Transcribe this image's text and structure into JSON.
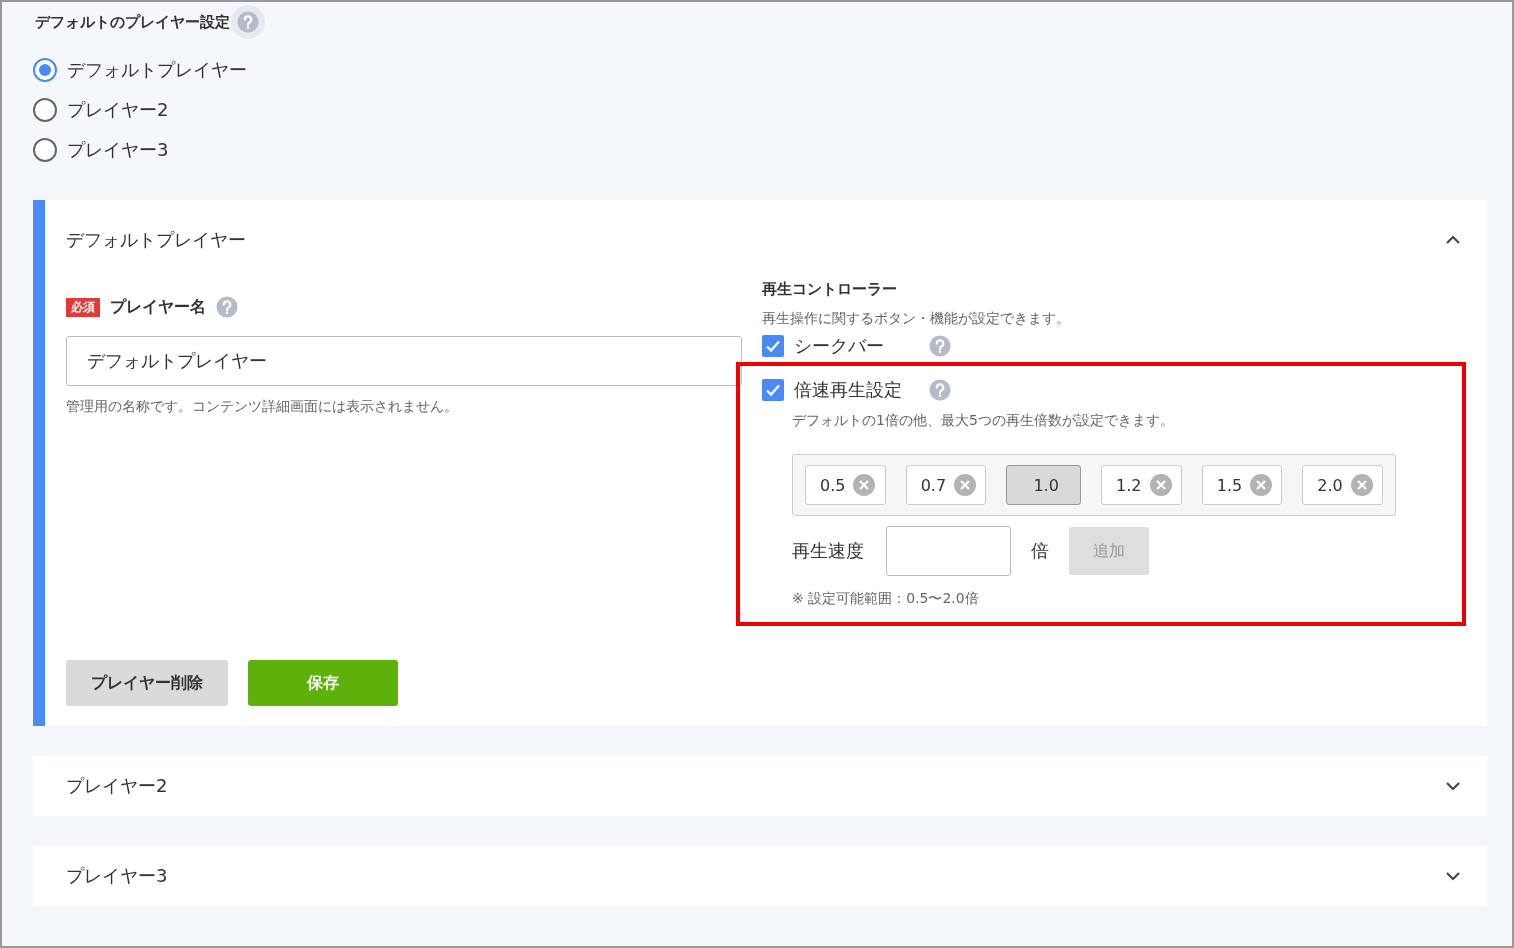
{
  "settings": {
    "title": "デフォルトのプレイヤー設定",
    "has_help": true
  },
  "player_options": [
    {
      "label": "デフォルトプレイヤー",
      "selected": true
    },
    {
      "label": "プレイヤー2",
      "selected": false
    },
    {
      "label": "プレイヤー3",
      "selected": false
    }
  ],
  "panels": [
    {
      "title": "デフォルトプレイヤー",
      "expanded": true,
      "name_field": {
        "required_badge": "必須",
        "label": "プレイヤー名",
        "value": "デフォルトプレイヤー",
        "hint": "管理用の名称です。コンテンツ詳細画面には表示されません。"
      },
      "controller": {
        "title": "再生コントローラー",
        "description": "再生操作に関するボタン・機能が設定できます。",
        "options": [
          {
            "label": "シークバー",
            "checked": true,
            "highlighted": false
          },
          {
            "label": "倍速再生設定",
            "checked": true,
            "highlighted": true,
            "description": "デフォルトの1倍の他、最大5つの再生倍数が設定できます。",
            "speeds": [
              {
                "label": "0.5",
                "kind": "removable"
              },
              {
                "label": "0.7",
                "kind": "removable"
              },
              {
                "label": "1.0",
                "kind": "default"
              },
              {
                "label": "1.2",
                "kind": "removable"
              },
              {
                "label": "1.5",
                "kind": "removable"
              },
              {
                "label": "2.0",
                "kind": "removable"
              }
            ],
            "speed_label": "再生速度",
            "unit": "倍",
            "add_button": {
              "label": "追加",
              "disabled": true
            },
            "note": "※ 設定可能範囲：0.5〜2.0倍"
          }
        ]
      },
      "buttons": [
        {
          "label": "プレイヤー削除",
          "kind": "secondary"
        },
        {
          "label": "保存",
          "kind": "primary"
        }
      ]
    },
    {
      "title": "プレイヤー2",
      "expanded": false
    },
    {
      "title": "プレイヤー3",
      "expanded": false
    }
  ]
}
